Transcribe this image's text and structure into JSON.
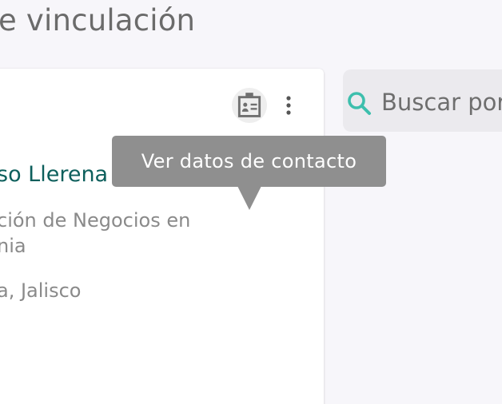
{
  "header": {
    "title": "e vinculación"
  },
  "card": {
    "name": "so Llerena",
    "program_line1": "ción de Negocios en",
    "program_line2": "nia",
    "location": "a, Jalisco",
    "contact_icon": "contact-card-icon",
    "more_icon": "more-vertical-icon"
  },
  "tooltip": {
    "text": "Ver datos de contacto"
  },
  "search": {
    "placeholder": "Buscar por",
    "icon": "search-icon",
    "accent_color": "#3dbfad"
  },
  "colors": {
    "name": "#0d5f5c",
    "tooltip_bg": "#8f8f8f",
    "page_bg": "#f7f6fa"
  }
}
